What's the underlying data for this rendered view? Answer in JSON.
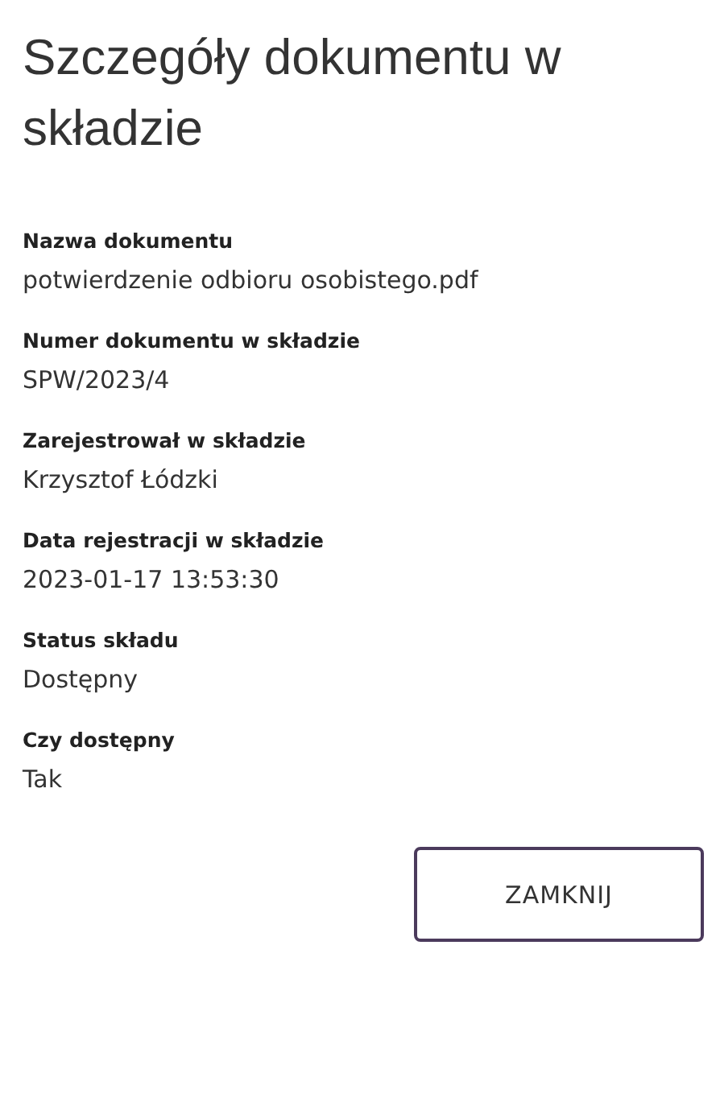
{
  "title": "Szczegóły dokumentu w składzie",
  "fields": [
    {
      "label": "Nazwa dokumentu",
      "value": "potwierdzenie odbioru osobistego.pdf"
    },
    {
      "label": "Numer dokumentu w składzie",
      "value": "SPW/2023/4"
    },
    {
      "label": "Zarejestrował w składzie",
      "value": "Krzysztof Łódzki"
    },
    {
      "label": "Data rejestracji w składzie",
      "value": "2023-01-17 13:53:30"
    },
    {
      "label": "Status składu",
      "value": "Dostępny"
    },
    {
      "label": "Czy dostępny",
      "value": "Tak"
    }
  ],
  "buttons": [
    "ZAMKNIJ"
  ]
}
